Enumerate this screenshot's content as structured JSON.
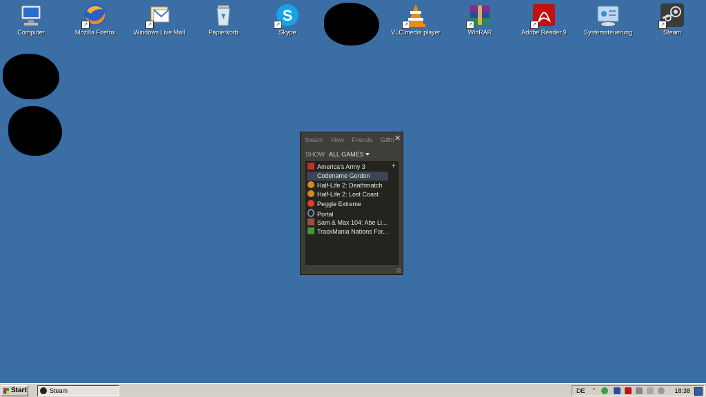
{
  "desktop": {
    "background": "#3a6ea5",
    "icons": [
      {
        "label": "Computer",
        "icon": "computer-icon"
      },
      {
        "label": "Mozilla Firefox",
        "icon": "firefox-icon"
      },
      {
        "label": "Windows Live Mail",
        "icon": "live-mail-icon"
      },
      {
        "label": "Papierkorb",
        "icon": "recycle-bin-icon"
      },
      {
        "label": "Skype",
        "icon": "skype-icon"
      },
      {
        "label": "VLC media player",
        "icon": "vlc-icon"
      },
      {
        "label": "WinRAR",
        "icon": "winrar-icon"
      },
      {
        "label": "Adobe Reader 9",
        "icon": "adobe-reader-icon"
      },
      {
        "label": "Systemsteuerung",
        "icon": "control-panel-icon"
      },
      {
        "label": "Steam",
        "icon": "steam-icon"
      }
    ]
  },
  "steam_window": {
    "menu": [
      "Steam",
      "View",
      "Friends",
      "Gam"
    ],
    "minimize": "–",
    "close": "✕",
    "show_label": "SHOW",
    "filter": "ALL GAMES",
    "add": "+",
    "games": [
      {
        "name": "America's Army 3",
        "icon": "americas-army-icon",
        "color": "#c03030"
      },
      {
        "name": "Codename Gordon",
        "icon": "",
        "color": ""
      },
      {
        "name": "Half-Life 2: Deathmatch",
        "icon": "half-life-icon",
        "color": "#d08a20"
      },
      {
        "name": "Half-Life 2: Lost Coast",
        "icon": "half-life-icon",
        "color": "#d08a20"
      },
      {
        "name": "Peggle Extreme",
        "icon": "peggle-icon",
        "color": "#e04020"
      },
      {
        "name": "Portal",
        "icon": "portal-icon",
        "color": "#6a8cb0"
      },
      {
        "name": "Sam & Max 104: Abe Li...",
        "icon": "sam-max-icon",
        "color": "#a05040"
      },
      {
        "name": "TrackMania Nations For...",
        "icon": "trackmania-icon",
        "color": "#3a9a3a"
      }
    ],
    "selected_index": 1
  },
  "taskbar": {
    "start_label": "Start",
    "task_label": "Steam",
    "language": "DE",
    "clock": "18:38"
  }
}
